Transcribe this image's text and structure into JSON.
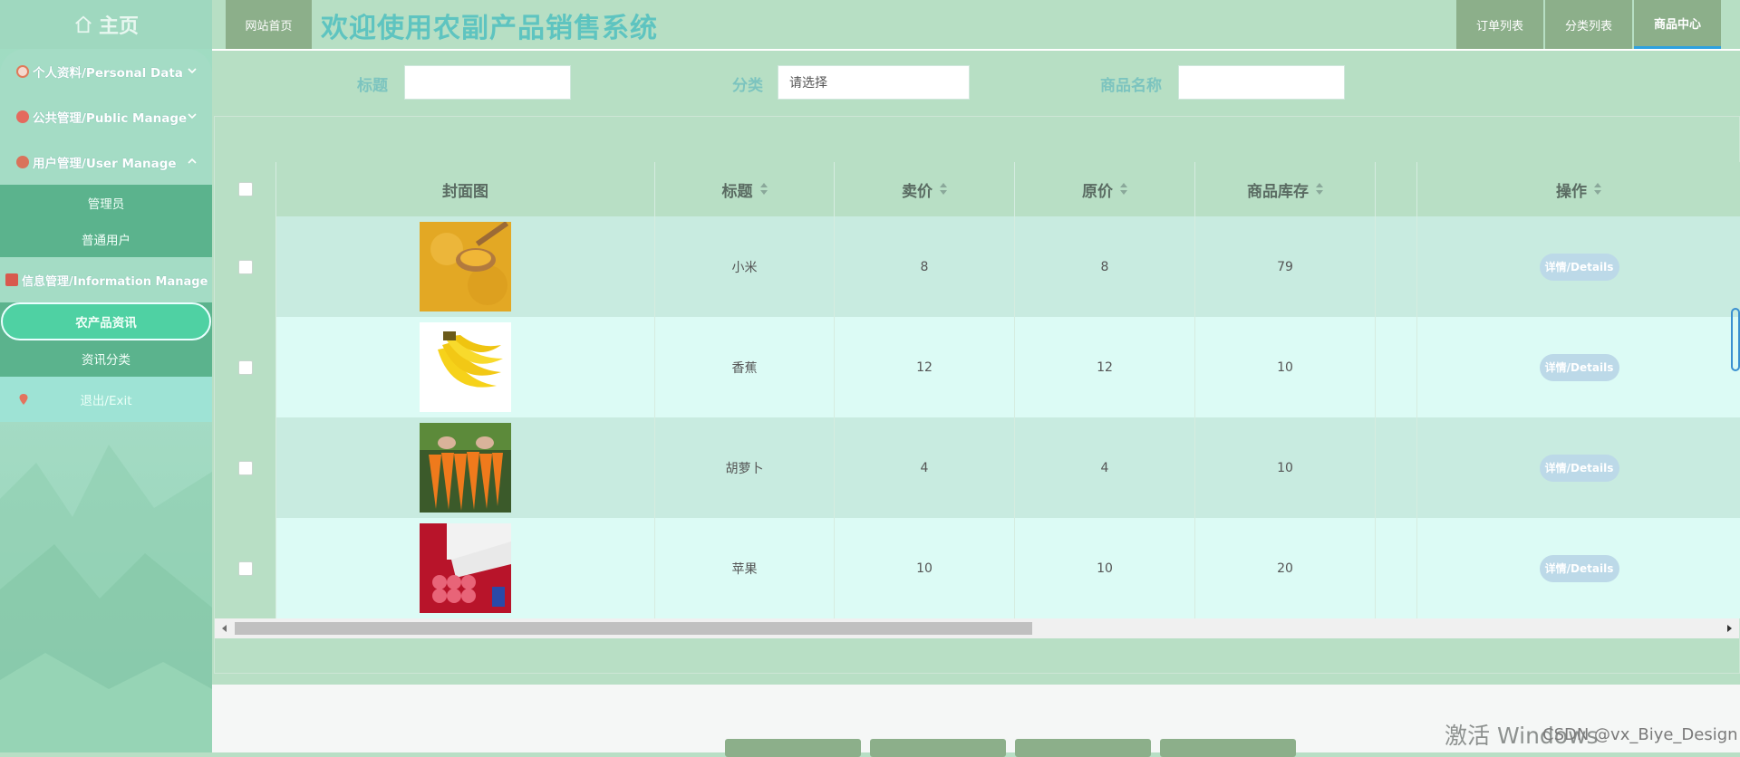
{
  "sidebar": {
    "home_label": "主页",
    "menus": [
      {
        "label": "个人资料/Personal Data",
        "icon": "flag-icon",
        "color": "#e07a5a"
      },
      {
        "label": "公共管理/Public Manage",
        "icon": "public-icon",
        "color": "#e46a5e"
      },
      {
        "label": "用户管理/User Manage",
        "icon": "user-icon",
        "color": "#d9735b"
      },
      {
        "label": "信息管理/Information Manage",
        "icon": "info-icon",
        "color": "#d85a4e"
      }
    ],
    "user_sub": [
      "管理员",
      "普通用户"
    ],
    "info_sub": [
      "农产品资讯",
      "资讯分类"
    ],
    "exit_label": "退出/Exit"
  },
  "topbar": {
    "home_btn": "网站首页",
    "title": "欢迎使用农副产品销售系统",
    "right_tabs": [
      "订单列表",
      "分类列表",
      "商品中心"
    ],
    "active_tab": "商品中心"
  },
  "search": {
    "title_label": "标题",
    "title_value": "",
    "category_label": "分类",
    "category_placeholder": "请选择",
    "name_label": "商品名称",
    "name_value": ""
  },
  "table": {
    "columns": [
      "封面图",
      "标题",
      "卖价",
      "原价",
      "商品库存",
      "操作"
    ],
    "rows": [
      {
        "title": "小米",
        "price": "8",
        "original": "8",
        "stock": "79",
        "image": "millet-image"
      },
      {
        "title": "香蕉",
        "price": "12",
        "original": "12",
        "stock": "10",
        "image": "banana-image"
      },
      {
        "title": "胡萝卜",
        "price": "4",
        "original": "4",
        "stock": "10",
        "image": "carrot-image"
      },
      {
        "title": "苹果",
        "price": "10",
        "original": "10",
        "stock": "20",
        "image": "apple-image"
      }
    ],
    "detail_label": "详情/Details"
  },
  "watermark": {
    "text": "激活 Windows",
    "credit": "CSDN @vx_Biye_Design"
  },
  "colors": {
    "accent": "#4fd1a3",
    "topbar_btn": "#8caf8a",
    "title": "#5ec4c0"
  }
}
